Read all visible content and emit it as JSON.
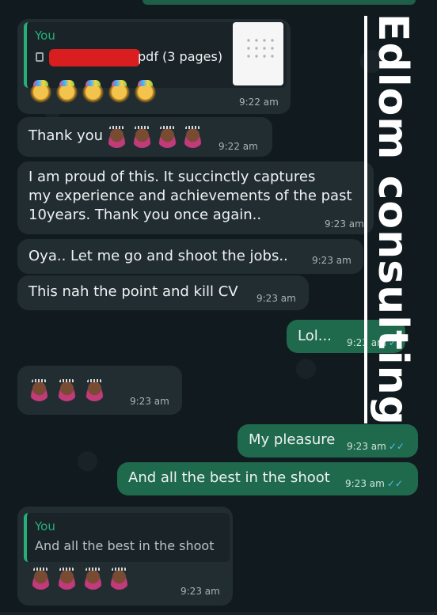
{
  "watermark": "Edlom consulting",
  "messages": [
    {
      "sender": "You",
      "doc_label": "pdf (3 pages)",
      "reactions": [
        "🥳",
        "🥳",
        "🥳",
        "🥳",
        "🥳"
      ],
      "time": "9:22 am"
    },
    {
      "text": "Thank you",
      "reactions": [
        "🙇",
        "🙇",
        "🙇",
        "🙇"
      ],
      "time": "9:22 am"
    },
    {
      "lines": [
        "I am proud of this. It succinctly captures",
        "my experience and achievements of the past",
        "10years. Thank you once again.."
      ],
      "time": "9:23 am"
    },
    {
      "text": "Oya.. Let me go and shoot the jobs..",
      "time": "9:23 am"
    },
    {
      "text": "This nah the point and kill CV",
      "time": "9:23 am"
    },
    {
      "text": "Lol...",
      "time": "9:23 am"
    },
    {
      "reactions": [
        "🙇",
        "🙇",
        "🙇"
      ],
      "time": "9:23 am"
    },
    {
      "text": "My pleasure",
      "time": "9:23 am"
    },
    {
      "text": "And all the best in the shoot",
      "time": "9:23 am"
    },
    {
      "quote_sender": "You",
      "quote_text": "And all the best in the shoot",
      "reactions": [
        "🙇",
        "🙇",
        "🙇",
        "🙇"
      ],
      "time": "9:23 am"
    }
  ],
  "colors": {
    "incoming": "#222d32",
    "outgoing": "#1f6a4c",
    "sender": "#25b07a",
    "read_tick": "#53bdeb"
  }
}
